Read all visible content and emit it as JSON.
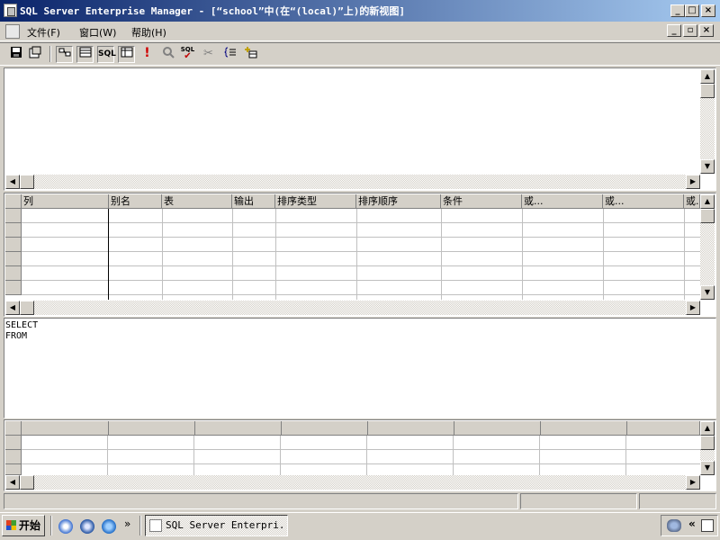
{
  "window": {
    "title": "SQL Server Enterprise Manager - [“school”中(在“(local)”上)的新视图]",
    "minimize_glyph": "_",
    "maximize_glyph": "□",
    "close_glyph": "×"
  },
  "menu": {
    "items": [
      {
        "label": "文件(F)"
      },
      {
        "label": "窗口(W)"
      },
      {
        "label": "帮助(H)"
      }
    ],
    "mdi_restore_glyph": "🗗"
  },
  "toolbar": {
    "sql_label": "SQL",
    "run_glyph": "!",
    "verify_label": "SQL"
  },
  "criteria_grid": {
    "columns": [
      "列",
      "别名",
      "表",
      "输出",
      "排序类型",
      "排序顺序",
      "条件",
      "或...",
      "或...",
      "或..."
    ],
    "row_count": 6
  },
  "sql_pane": {
    "lines": [
      "SELECT",
      "FROM"
    ]
  },
  "results_grid": {
    "row_count": 3
  },
  "taskbar": {
    "start_label": "开始",
    "task_label": "SQL Server Enterpri...",
    "chevron": "»",
    "tray_chevron": "«"
  }
}
